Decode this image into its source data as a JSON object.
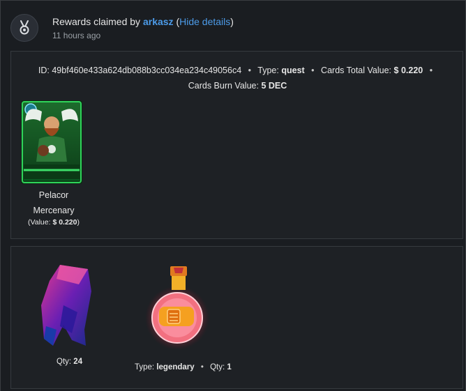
{
  "header": {
    "title_prefix": "Rewards claimed by",
    "username": "arkasz",
    "paren_open": "(",
    "hide_details": "Hide details",
    "paren_close": ")",
    "time": "11 hours ago",
    "avatar_icon": "medal-icon"
  },
  "details": {
    "id_label": "ID:",
    "id_value": "49bf460e433a624db088b3cc034ea234c49056c4",
    "type_label": "Type:",
    "type_value": "quest",
    "cards_total_label": "Cards Total Value:",
    "cards_total_value": "$ 0.220",
    "cards_burn_label": "Cards Burn Value:",
    "cards_burn_value": "5 DEC"
  },
  "card": {
    "name_line1": "Pelacor",
    "name_line2": "Mercenary",
    "value_prefix": "(Value:",
    "value": "$ 0.220",
    "value_suffix": ")"
  },
  "items": {
    "gem": {
      "qty_label": "Qty:",
      "qty": "24",
      "icon": "energy-crystal-icon"
    },
    "potion": {
      "type_label": "Type:",
      "type": "legendary",
      "qty_label": "Qty:",
      "qty": "1",
      "icon": "legendary-potion-icon"
    }
  }
}
